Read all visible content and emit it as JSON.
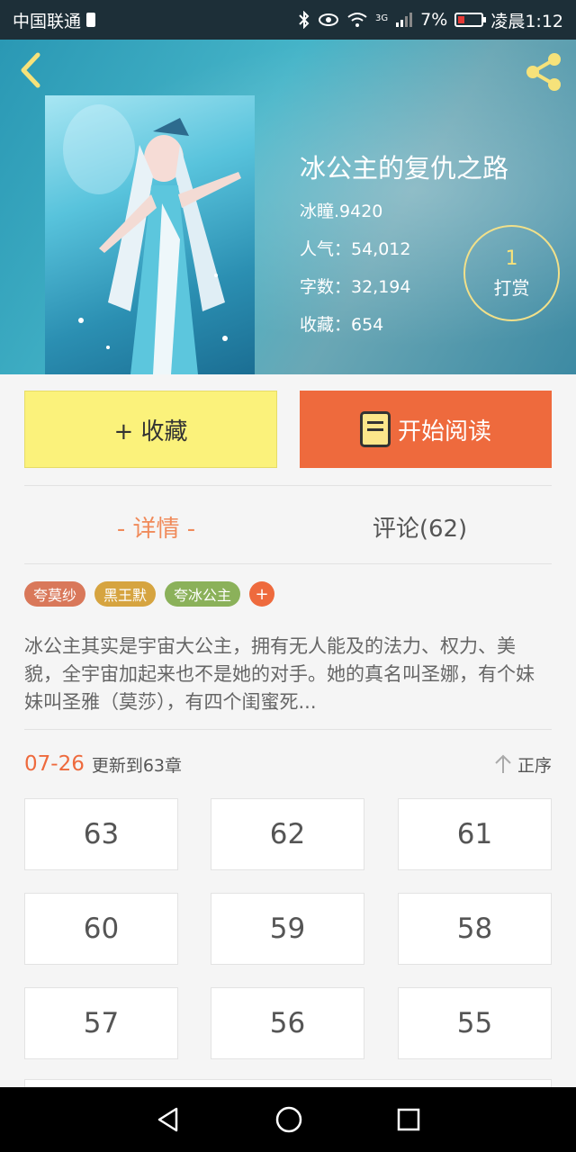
{
  "status_bar": {
    "carrier": "中国联通",
    "network": "3G",
    "battery": "7%",
    "battery_level": 0.07,
    "time": "凌晨1:12"
  },
  "book": {
    "title": "冰公主的复仇之路",
    "author": "冰瞳.9420",
    "popularity": "人气：54,012",
    "word_count": "字数：32,194",
    "favorites": "收藏：654"
  },
  "reward": {
    "count": "1",
    "label": "打赏"
  },
  "actions": {
    "favorite_label": "+ 收藏",
    "read_label": "开始阅读"
  },
  "tabs": [
    {
      "label": "- 详情 -"
    },
    {
      "label": "评论(62)"
    }
  ],
  "tags": [
    {
      "label": "夸莫纱",
      "color": "#d9785a"
    },
    {
      "label": "黑王默",
      "color": "#d6a440"
    },
    {
      "label": "夸冰公主",
      "color": "#8bb15a"
    }
  ],
  "tag_add_label": "+",
  "description": "冰公主其实是宇宙大公主，拥有无人能及的法力、权力、美貌，全宇宙加起来也不是她的对手。她的真名叫圣娜，有个妹妹叫圣雅（莫莎），有四个闺蜜死...",
  "update": {
    "date": "07-26",
    "text": "更新到63章",
    "sort_label": "正序"
  },
  "chapters": [
    "63",
    "62",
    "61",
    "60",
    "59",
    "58",
    "57",
    "56",
    "55"
  ],
  "colors": {
    "accent": "#ee6a3d",
    "favorite_bg": "#fbf27b",
    "status_bar": "#1d2f38"
  }
}
